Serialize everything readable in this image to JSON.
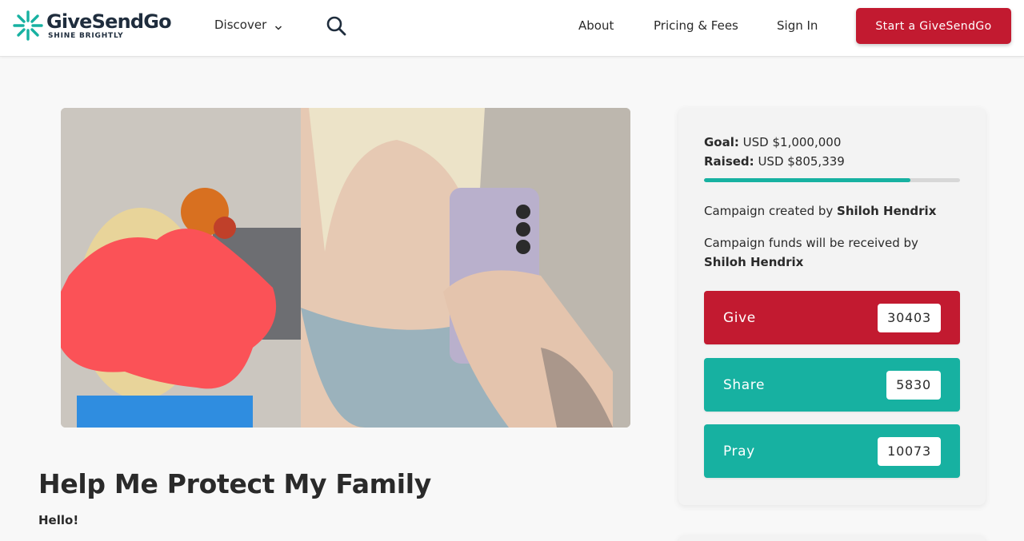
{
  "header": {
    "logo_name": "GiveSendGo",
    "logo_tagline": "SHINE BRIGHTLY",
    "discover_label": "Discover",
    "about_label": "About",
    "pricing_label": "Pricing & Fees",
    "signin_label": "Sign In",
    "start_label": "Start a GiveSendGo"
  },
  "campaign": {
    "title": "Help Me Protect My Family",
    "intro": "Hello!"
  },
  "sidebar": {
    "goal_label": "Goal:",
    "goal_value": "USD $1,000,000",
    "raised_label": "Raised:",
    "raised_value": "USD $805,339",
    "progress_fraction": 0.805,
    "created_prefix": "Campaign created by",
    "creator_name": "Shiloh Hendrix",
    "funds_prefix": "Campaign funds will be received by",
    "recipient_name": "Shiloh Hendrix",
    "give": {
      "label": "Give",
      "count": "30403"
    },
    "share": {
      "label": "Share",
      "count": "5830"
    },
    "pray": {
      "label": "Pray",
      "count": "10073"
    }
  },
  "colors": {
    "brand_red": "#c21a30",
    "brand_teal": "#17b1a1",
    "logo_dark": "#1f2d3d"
  },
  "icons": {
    "logo": "sunburst-logo-icon",
    "discover": "chevron-down-icon",
    "search": "search-icon"
  }
}
